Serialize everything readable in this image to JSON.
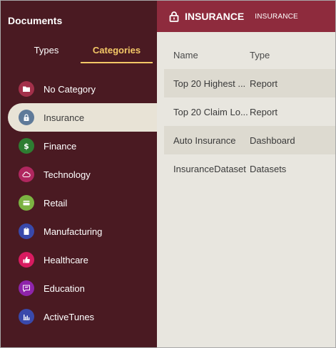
{
  "sidebar": {
    "title": "Documents",
    "tabs": [
      {
        "label": "Types",
        "active": false
      },
      {
        "label": "Categories",
        "active": true
      }
    ],
    "categories": [
      {
        "label": "No Category",
        "icon": "folder-icon",
        "color": "#a3304a",
        "selected": false
      },
      {
        "label": "Insurance",
        "icon": "lock-icon",
        "color": "#5f7a99",
        "selected": true
      },
      {
        "label": "Finance",
        "icon": "dollar-icon",
        "color": "#2e7d32",
        "selected": false
      },
      {
        "label": "Technology",
        "icon": "cloud-icon",
        "color": "#b0275f",
        "selected": false
      },
      {
        "label": "Retail",
        "icon": "card-icon",
        "color": "#7cb342",
        "selected": false
      },
      {
        "label": "Manufacturing",
        "icon": "clipboard-icon",
        "color": "#3949ab",
        "selected": false
      },
      {
        "label": "Healthcare",
        "icon": "thumbs-up-icon",
        "color": "#d81b60",
        "selected": false
      },
      {
        "label": "Education",
        "icon": "chat-icon",
        "color": "#8e24aa",
        "selected": false
      },
      {
        "label": "ActiveTunes",
        "icon": "bar-chart-icon",
        "color": "#3949ab",
        "selected": false
      }
    ]
  },
  "header": {
    "title": "INSURANCE",
    "subtitle": "INSURANCE",
    "icon": "lock-icon",
    "color": "#8e2b3d"
  },
  "table": {
    "columns": [
      "Name",
      "Type"
    ],
    "rows": [
      {
        "name": "Top 20 Highest ...",
        "type": "Report"
      },
      {
        "name": "Top 20 Claim Lo...",
        "type": "Report"
      },
      {
        "name": "Auto Insurance",
        "type": "Dashboard"
      },
      {
        "name": "InsuranceDataset",
        "type": "Datasets"
      }
    ]
  }
}
